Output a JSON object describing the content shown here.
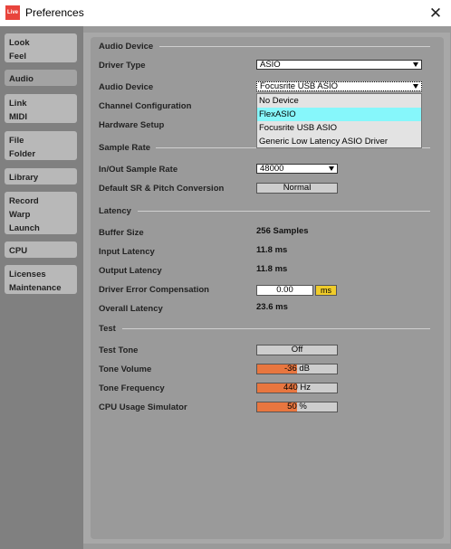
{
  "window": {
    "title": "Preferences",
    "app_icon_text": "Live"
  },
  "sidebar": {
    "tabs": [
      {
        "lines": [
          "Look",
          "Feel"
        ]
      },
      {
        "lines": [
          "Audio"
        ]
      },
      {
        "lines": [
          "Link",
          "MIDI"
        ]
      },
      {
        "lines": [
          "File",
          "Folder"
        ]
      },
      {
        "lines": [
          "Library"
        ]
      },
      {
        "lines": [
          "Record",
          "Warp",
          "Launch"
        ]
      },
      {
        "lines": [
          "CPU"
        ]
      },
      {
        "lines": [
          "Licenses",
          "Maintenance"
        ]
      }
    ],
    "active_tab": "Audio"
  },
  "sections": {
    "audio_device": "Audio Device",
    "sample_rate": "Sample Rate",
    "latency": "Latency",
    "test": "Test"
  },
  "fields": {
    "driver_type": {
      "label": "Driver Type",
      "value": "ASIO"
    },
    "audio_device": {
      "label": "Audio Device",
      "value": "Focusrite USB ASIO"
    },
    "channel_configuration": {
      "label": "Channel Configuration"
    },
    "hardware_setup": {
      "label": "Hardware Setup"
    },
    "in_out_sample_rate": {
      "label": "In/Out Sample Rate",
      "value": "48000"
    },
    "default_sr_pitch": {
      "label": "Default SR & Pitch Conversion",
      "value": "Normal"
    },
    "buffer_size": {
      "label": "Buffer Size",
      "value": "256 Samples"
    },
    "input_latency": {
      "label": "Input Latency",
      "value": "11.8 ms"
    },
    "output_latency": {
      "label": "Output Latency",
      "value": "11.8 ms"
    },
    "driver_error_compensation": {
      "label": "Driver Error Compensation",
      "value": "0.00",
      "unit": "ms"
    },
    "overall_latency": {
      "label": "Overall Latency",
      "value": "23.6 ms"
    },
    "test_tone": {
      "label": "Test Tone",
      "value": "Off"
    },
    "tone_volume": {
      "label": "Tone Volume",
      "value": "-36 dB",
      "level": 0.5
    },
    "tone_frequency": {
      "label": "Tone Frequency",
      "value": "440 Hz",
      "level": 0.5
    },
    "cpu_usage_simulator": {
      "label": "CPU Usage Simulator",
      "value": "50 %",
      "level": 0.5
    }
  },
  "audio_device_menu": {
    "options": [
      "No Device",
      "FlexASIO",
      "Focusrite USB ASIO",
      "Generic Low Latency ASIO Driver"
    ],
    "highlighted": "FlexASIO"
  },
  "colors": {
    "accent_orange": "#e8763f",
    "highlight_cyan": "#86f7fb",
    "unit_yellow": "#f0cc2a"
  }
}
